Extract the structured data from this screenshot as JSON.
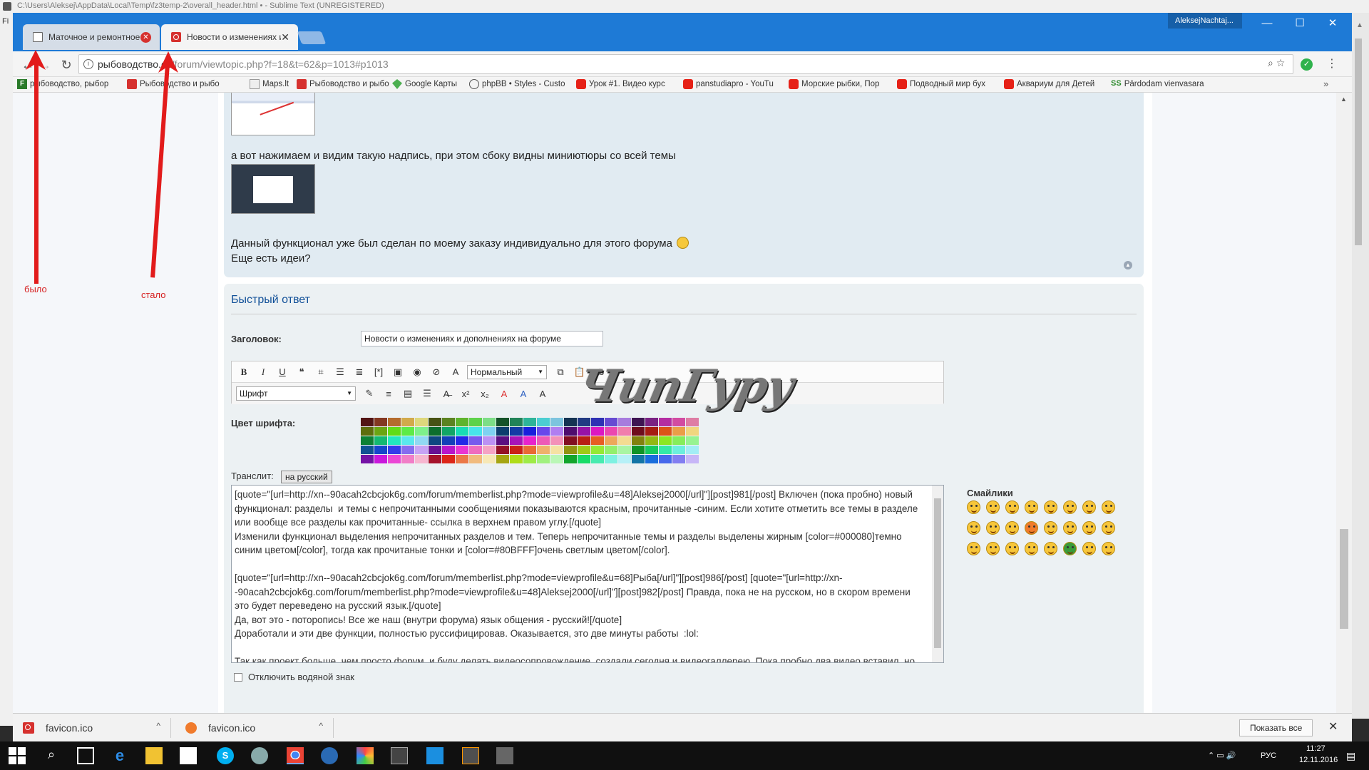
{
  "sublime": {
    "title": "C:\\Users\\Aleksej\\AppData\\Local\\Temp\\fz3temp-2\\overall_header.html • - Sublime Text (UNREGISTERED)",
    "menu_letter": "Fi"
  },
  "window": {
    "user": "AleksejNachtaj...",
    "min": "—",
    "max": "☐",
    "close": "✕"
  },
  "tabs": [
    {
      "label": "Маточное и ремонтное",
      "close": "✕"
    },
    {
      "label": "Новости о изменениях и",
      "close": "✕"
    }
  ],
  "address": {
    "host": "рыбоводство.co",
    "path": "/forum/viewtopic.php?f=18&t=62&p=1013#p1013",
    "info": "i"
  },
  "bookmarks": [
    {
      "label": "рыбоводство, рыбор",
      "icon": "f-icon"
    },
    {
      "label": "Рыбоводство и рыбо",
      "icon": "forum-icon"
    },
    {
      "label": "Maps.lt",
      "icon": "maps-icon"
    },
    {
      "label": "Рыбоводство и рыбо",
      "icon": "puzzle-icon"
    },
    {
      "label": "Google Карты",
      "icon": "google-maps-icon"
    },
    {
      "label": "phpBB • Styles - Custo",
      "icon": "styles-icon"
    },
    {
      "label": "Урок #1. Видео курс",
      "icon": "youtube-icon"
    },
    {
      "label": "panstudiapro - YouTu",
      "icon": "youtube-icon"
    },
    {
      "label": "Морские рыбки, Пор",
      "icon": "youtube-icon"
    },
    {
      "label": "Подводный мир бух",
      "icon": "youtube-icon"
    },
    {
      "label": "Аквариум для Детей",
      "icon": "youtube-icon"
    },
    {
      "label": "Pārdodam vienvasara",
      "icon": "ss-icon"
    }
  ],
  "bookmarks_ss": "SS",
  "bookmarks_more": "»",
  "post": {
    "line1": "а вот нажимаем и видим такую надпись, при этом сбоку видны миниютюры со всей темы",
    "line2": "Данный функционал уже был сделан по моему заказу индивидуально для этого форума",
    "line3": "Еще есть идеи?"
  },
  "reply": {
    "title": "Быстрый ответ",
    "subject_label": "Заголовок:",
    "subject_value": "Новости о изменениях и дополнениях на форуме",
    "size_select": "Нормальный",
    "font_select": "Шрифт",
    "color_label": "Цвет шрифта:",
    "translit_label": "Транслит:",
    "translit_button": "на русский",
    "smilies_label": "Смайлики",
    "watermark_label": "Отключить водяной знак",
    "editor_text": [
      "[quote=\"[url=http://xn--90acah2cbcjok6g.com/forum/memberlist.php?mode=viewprofile&u=48]Aleksej2000[/url]\"][post]981[/post] Включен (пока пробно) новый  функционал: разделы  и темы с непрочитанными сообщениями показываются красным, прочитанные -синим. Если хотите отметить все темы в разделе или вообще все разделы как прочитанные- ссылка в верхнем правом углу.[/quote]",
      "Изменили функционал выделения непрочитанных разделов и тем. Теперь непрочитанные темы и разделы выделены жирным [color=#000080]темно синим цветом[/color], тогда как прочитаные тонки и [color=#80BFFF]очень светлым цветом[/color].",
      "",
      "[quote=\"[url=http://xn--90acah2cbcjok6g.com/forum/memberlist.php?mode=viewprofile&u=68]Рыба[/url]\"][post]986[/post] [quote=\"[url=http://xn--90acah2cbcjok6g.com/forum/memberlist.php?mode=viewprofile&u=48]Aleksej2000[/url]\"][post]982[/post] Правда, пока не на русском, но в скором времени это будет переведено на русский язык.[/quote]",
      "Да, вот это - поторопись! Все же наш (внутри форума) язык общения - русский![/quote]",
      "Доработали и эти две функции, полностью руссифицировав. Оказывается, это две минуты работы  :lol:",
      "",
      "Так как проект больше, чем просто форум, и буду делать видеосопровождение, создали сегодня и видеогаллерею. Пока пробно два видео вставил, но над этим разделом нужно плотно поработать. У кого есть желание, можете вставлять туда видео :)"
    ]
  },
  "toolbar_buttons_r1": [
    {
      "name": "bold-button",
      "text": "B",
      "cls": "bold"
    },
    {
      "name": "italic-button",
      "text": "I",
      "cls": "ital"
    },
    {
      "name": "underline-button",
      "text": "U",
      "cls": "und"
    },
    {
      "name": "quote-button",
      "text": "❝",
      "cls": ""
    },
    {
      "name": "code-button",
      "text": "⌗",
      "cls": ""
    },
    {
      "name": "list-button",
      "text": "☰",
      "cls": ""
    },
    {
      "name": "ordered-list-button",
      "text": "≣",
      "cls": ""
    },
    {
      "name": "list-item-button",
      "text": "[*]",
      "cls": ""
    },
    {
      "name": "image-button",
      "text": "▣",
      "cls": ""
    },
    {
      "name": "url-button",
      "text": "◉",
      "cls": ""
    },
    {
      "name": "flash-button",
      "text": "⊘",
      "cls": ""
    },
    {
      "name": "font-color-button",
      "text": "A",
      "cls": ""
    }
  ],
  "toolbar_buttons_r1_after": [
    {
      "name": "copy-button",
      "text": "⧉"
    },
    {
      "name": "paste-button",
      "text": "📋"
    },
    {
      "name": "spellcheck-button",
      "text": "ab"
    }
  ],
  "toolbar_buttons_r2": [
    {
      "name": "highlight-button",
      "text": "✎"
    },
    {
      "name": "align-center-button",
      "text": "≡"
    },
    {
      "name": "align-block-button",
      "text": "▤"
    },
    {
      "name": "justify-button",
      "text": "☰"
    },
    {
      "name": "strike-button",
      "text": "A̶"
    },
    {
      "name": "superscript-button",
      "text": "x²"
    },
    {
      "name": "subscript-button",
      "text": "x₂"
    },
    {
      "name": "text-color-button",
      "text": "A"
    },
    {
      "name": "text-shadow-button",
      "text": "A"
    },
    {
      "name": "text-glow-button",
      "text": "A"
    }
  ],
  "annotations": {
    "was": "было",
    "now": "стало"
  },
  "watermark_logo": "ЧипГуру",
  "downloads": {
    "items": [
      {
        "label": "favicon.ico",
        "chev": "^"
      },
      {
        "label": "favicon.ico",
        "chev": "^"
      }
    ],
    "show_all": "Показать все",
    "close": "✕"
  },
  "taskbar": {
    "lang": "РУС",
    "time": "11:27",
    "date": "12.11.2016"
  },
  "colors": {
    "titlebar": "#1e7ad6",
    "post_bg": "#e1ebf2",
    "reply_bg": "#ecf1f3",
    "link_blue": "#115098",
    "annotation_red": "#e21b1b"
  }
}
